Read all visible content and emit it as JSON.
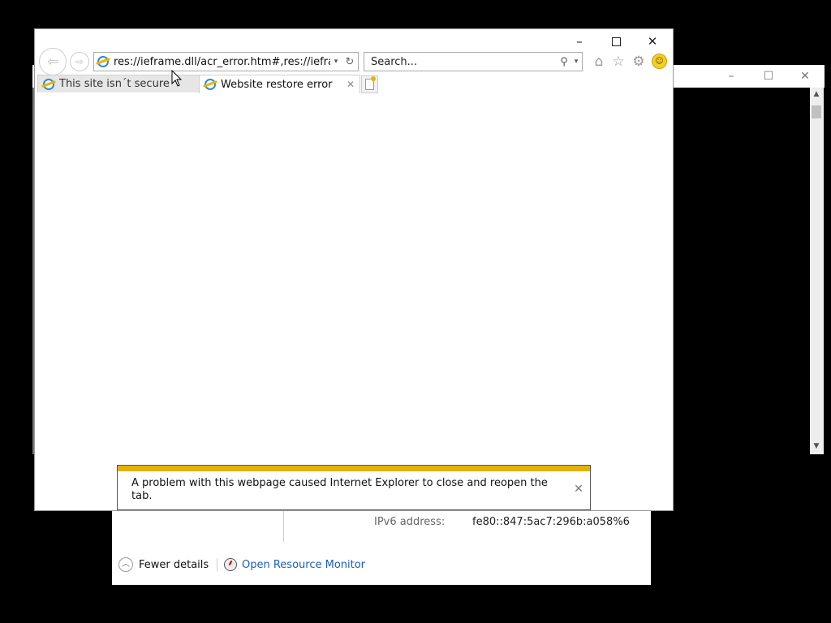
{
  "console_window": {
    "caption": {
      "minimize": "–",
      "maximize": "☐",
      "close": "✕"
    }
  },
  "ie": {
    "caption": {
      "minimize": "–",
      "close": "✕"
    },
    "nav": {
      "back": "⇦",
      "forward": "⇨"
    },
    "address": {
      "url": "res://ieframe.dll/acr_error.htm#,res://ieframe.dll",
      "dropdown": "▾",
      "refresh": "↻"
    },
    "search": {
      "placeholder": "Search...",
      "icon": "⚲",
      "dropdown": "▾"
    },
    "toolbar": {
      "home_glyph": "⌂",
      "favorites_glyph": "☆",
      "tools_glyph": "⚙",
      "feedback_glyph": "☺"
    },
    "tabs": [
      {
        "title": "This site isn´t secure",
        "active": false
      },
      {
        "title": "Website restore error",
        "active": true,
        "close_glyph": "✕"
      }
    ],
    "notification": {
      "message": "A problem with this webpage caused Internet Explorer to close and reopen the tab.",
      "close_glyph": "✕",
      "accent_color": "#e2b10d"
    }
  },
  "task_manager": {
    "ipv6_label": "IPv6 address:",
    "ipv6_value": "fe80::847:5ac7:296b:a058%6",
    "fewer_details_label": "Fewer details",
    "chevron_glyph": "︿",
    "open_resource_monitor_label": "Open Resource Monitor",
    "link_color": "#1a5fb4"
  }
}
